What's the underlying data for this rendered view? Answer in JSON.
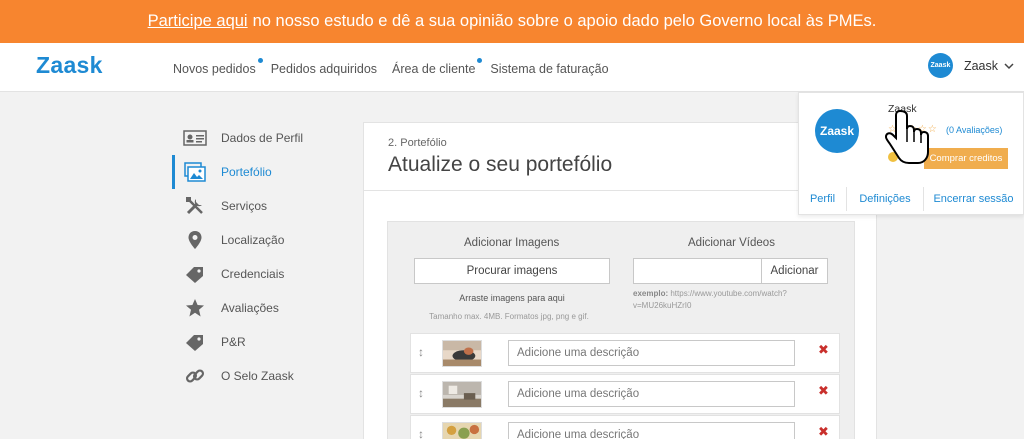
{
  "banner": {
    "link": "Participe aqui",
    "text": "no nosso estudo e dê a sua opinião sobre o apoio dado pelo Governo local às PMEs."
  },
  "header": {
    "logo": "Zaask",
    "nav": [
      {
        "label": "Novos pedidos",
        "dot": true
      },
      {
        "label": "Pedidos adquiridos",
        "dot": false
      },
      {
        "label": "Área de cliente",
        "dot": true
      },
      {
        "label": "Sistema de faturação",
        "dot": false
      }
    ],
    "user": {
      "avatar_text": "Zaask",
      "name": "Zaask"
    }
  },
  "sidebar": {
    "items": [
      {
        "label": "Dados de Perfil",
        "icon": "id-card-icon",
        "active": false
      },
      {
        "label": "Portefólio",
        "icon": "pictures-icon",
        "active": true
      },
      {
        "label": "Serviços",
        "icon": "tools-icon",
        "active": false
      },
      {
        "label": "Localização",
        "icon": "map-pin-icon",
        "active": false
      },
      {
        "label": "Credenciais",
        "icon": "tag-icon",
        "active": false
      },
      {
        "label": "Avaliações",
        "icon": "star-icon",
        "active": false
      },
      {
        "label": "P&R",
        "icon": "tag-icon",
        "active": false
      },
      {
        "label": "O Selo Zaask",
        "icon": "link-icon",
        "active": false
      }
    ]
  },
  "main": {
    "step": "2. Portefólio",
    "title": "Atualize o seu portefólio",
    "images": {
      "heading": "Adicionar Imagens",
      "browse_label": "Procurar imagens",
      "drag_hint": "Arraste imagens para aqui",
      "size_hint": "Tamanho max. 4MB. Formatos jpg, png e gif."
    },
    "videos": {
      "heading": "Adicionar Vídeos",
      "input_value": "",
      "add_label": "Adicionar",
      "example_label": "exemplo:",
      "example_url": "https://www.youtube.com/watch?v=MU26kuHZrI0"
    },
    "rows": [
      {
        "placeholder": "Adicione uma descrição",
        "handle": "↕",
        "remove": "✖"
      },
      {
        "placeholder": "Adicione uma descrição",
        "handle": "↕",
        "remove": "✖"
      },
      {
        "placeholder": "Adicione uma descrição",
        "handle": "↕",
        "remove": "✖"
      }
    ]
  },
  "dropdown": {
    "avatar_text": "Zaask",
    "name": "Zaask",
    "stars": "☆☆☆☆☆",
    "rating": "(0 Avaliações)",
    "buy_label": "Comprar creditos",
    "links": [
      "Perfil",
      "Definições",
      "Encerrar sessão"
    ]
  },
  "colors": {
    "banner": "#f7852f",
    "accent": "#1e8ad3",
    "button_orange": "#f0ad4e",
    "remove_red": "#c9302c"
  }
}
